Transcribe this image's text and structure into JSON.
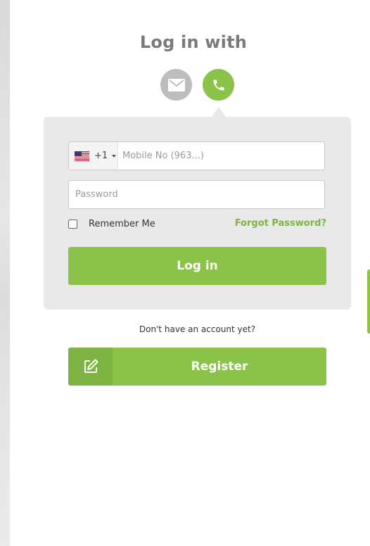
{
  "login": {
    "title": "Log in with",
    "methods": [
      {
        "icon": "envelope-icon",
        "state": "inactive"
      },
      {
        "icon": "phone-icon",
        "state": "active"
      }
    ],
    "colors": {
      "accent": "#8bc34a",
      "accent_dark": "#7cb342",
      "inactive": "#bdbdbd",
      "panel": "#e9e9e9",
      "title": "#7a7a7a"
    }
  },
  "form": {
    "country_code": "+1",
    "country_flag_icon": "us-flag-icon",
    "mobile_placeholder": "Mobile No (963...)",
    "mobile_value": "",
    "password_placeholder": "Password",
    "password_value": "",
    "remember_label": "Remember Me",
    "remember_checked": false,
    "forgot_label": "Forgot Password?",
    "login_button": "Log in"
  },
  "signup": {
    "prompt": "Don't have an account yet?",
    "register_button": "Register",
    "register_icon": "edit-icon"
  }
}
